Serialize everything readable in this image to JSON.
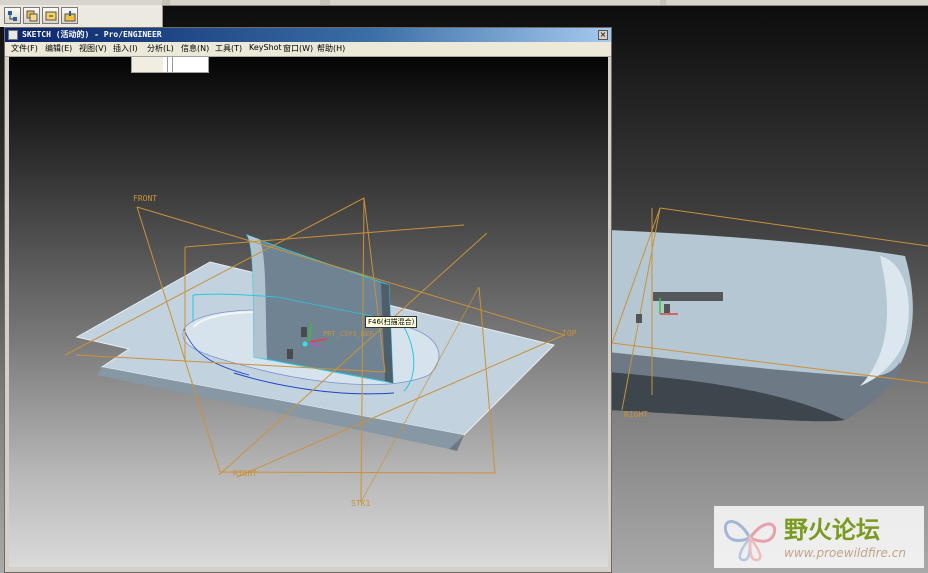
{
  "window": {
    "title": "SKETCH (活动的) - Pro/ENGINEER",
    "close_glyph": "×"
  },
  "menu": {
    "items": [
      "文件(F)",
      "编辑(E)",
      "视图(V)",
      "插入(I)",
      "分析(L)",
      "信息(N)",
      "工具(T)",
      "KeyShot",
      "窗口(W)",
      "帮助(H)"
    ]
  },
  "viewport": {
    "datum_labels": {
      "front": "FRONT",
      "right": "RIGHT",
      "top": "TOP",
      "stk": "STK1",
      "csys": "PRT_CSYS_DEF"
    },
    "tooltip": "F46(扫描混合)"
  },
  "background_viewport": {
    "datum_labels": {
      "right": "RIGHT"
    }
  },
  "watermark": {
    "title": "野火论坛",
    "url": "www.proewildfire.cn"
  },
  "colors": {
    "title_bar": "#0a246a",
    "datum_plane": "#c9923a",
    "sketch_edge": "#28c8e0",
    "part_surface": "#b9cbd8"
  }
}
